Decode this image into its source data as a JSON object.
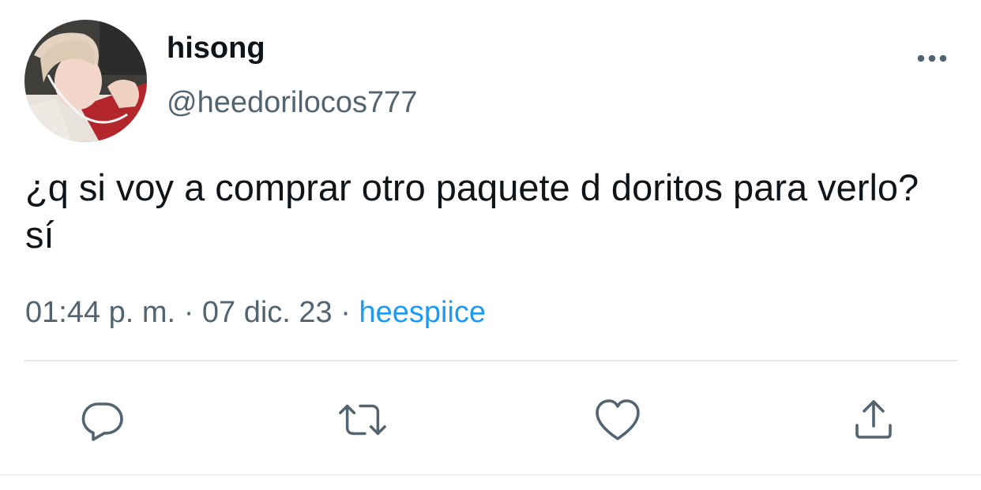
{
  "tweet": {
    "display_name": "hisong",
    "handle": "@heedorilocos777",
    "text": "¿q si voy a comprar otro paquete d doritos para verlo? sí",
    "time": "01:44 p. m.",
    "separator": "·",
    "date": "07 dic. 23",
    "source": "heespiice"
  },
  "icons": {
    "more": "more-dots-icon",
    "reply": "reply-bubble-icon",
    "retweet": "retweet-arrows-icon",
    "like": "heart-icon",
    "share": "share-upload-icon"
  },
  "colors": {
    "text": "#0f1419",
    "secondary": "#536471",
    "link": "#1d9bf0"
  }
}
